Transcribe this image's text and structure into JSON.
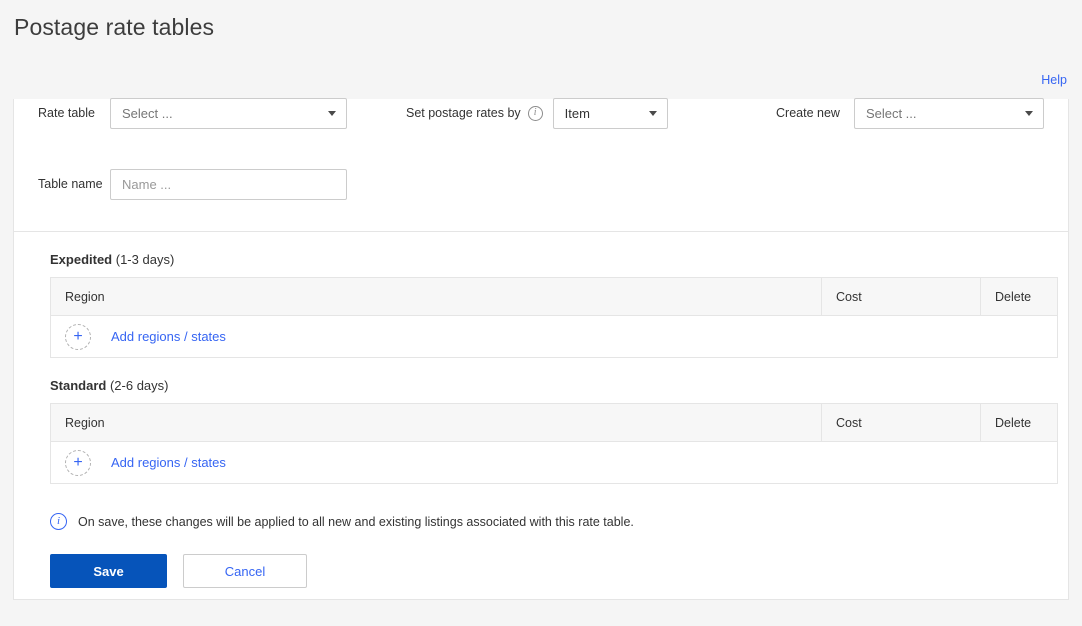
{
  "page": {
    "title": "Postage rate tables",
    "help_label": "Help",
    "background_color": "#f5f5f5",
    "accent_color": "#3665f3",
    "primary_button_color": "#0654ba"
  },
  "form": {
    "rate_table": {
      "label": "Rate table",
      "value": "Select ...",
      "caret_icon": "chevron-down-icon"
    },
    "postage_rates_by": {
      "label": "Set postage rates by",
      "info_icon": "info-icon",
      "value": "Item",
      "caret_icon": "chevron-down-icon"
    },
    "create_new": {
      "label": "Create new",
      "value": "Select ...",
      "caret_icon": "chevron-down-icon"
    },
    "table_name": {
      "label": "Table name",
      "value": "",
      "placeholder": "Name ..."
    }
  },
  "services": [
    {
      "name": "Expedited",
      "days": "(1-3 days)",
      "columns": {
        "region": "Region",
        "cost": "Cost",
        "delete": "Delete"
      },
      "rows": [],
      "add_label": "Add regions / states",
      "add_icon": "plus-icon"
    },
    {
      "name": "Standard",
      "days": "(2-6 days)",
      "columns": {
        "region": "Region",
        "cost": "Cost",
        "delete": "Delete"
      },
      "rows": [],
      "add_label": "Add regions / states",
      "add_icon": "plus-icon"
    }
  ],
  "notice": {
    "icon": "info-icon",
    "text": "On save, these changes will be applied to all new and existing listings associated with this rate table."
  },
  "actions": {
    "save_label": "Save",
    "cancel_label": "Cancel"
  }
}
